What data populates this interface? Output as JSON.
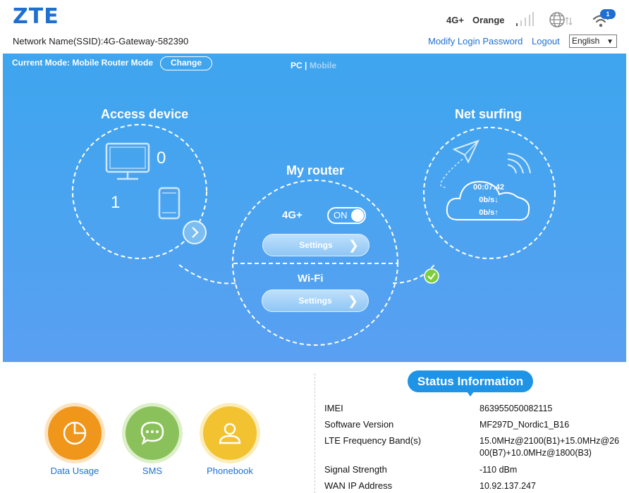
{
  "header": {
    "logo": "ZTE",
    "ssid": "Network Name(SSID):4G-Gateway-582390",
    "network_type": "4G+",
    "operator": "Orange",
    "wifi_badge": "1",
    "modify_password": "Modify Login Password",
    "logout": "Logout",
    "language": "English"
  },
  "panel": {
    "current_mode": "Current Mode: Mobile Router Mode",
    "change": "Change",
    "pc": "PC |",
    "mobile": "Mobile",
    "access_device": {
      "title": "Access device",
      "wired_count": "0",
      "wireless_count": "1"
    },
    "my_router": {
      "title": "My router",
      "mobile_label": "4G+",
      "toggle": "ON",
      "settings": "Settings",
      "wifi_label": "Wi-Fi",
      "wifi_settings": "Settings"
    },
    "net_surfing": {
      "title": "Net surfing",
      "duration": "00:07:42",
      "down": "0b/s↓",
      "up": "0b/s↑"
    }
  },
  "shortcuts": [
    {
      "label": "Data Usage",
      "color": "#f0961a"
    },
    {
      "label": "SMS",
      "color": "#8bc15a"
    },
    {
      "label": "Phonebook",
      "color": "#f2c230"
    }
  ],
  "status": {
    "title": "Status Information",
    "rows": [
      {
        "label": "IMEI",
        "value": "863955050082115"
      },
      {
        "label": "Software Version",
        "value": "MF297D_Nordic1_B16"
      },
      {
        "label": "LTE Frequency Band(s)",
        "value": "15.0MHz@2100(B1)+15.0MHz@2600(B7)+10.0MHz@1800(B3)"
      },
      {
        "label": "Signal Strength",
        "value": "-110 dBm"
      },
      {
        "label": "WAN IP Address",
        "value": "10.92.137.247"
      }
    ]
  },
  "colors": {
    "brand": "#1f6fd0",
    "panel_blue": "#4aa4f0",
    "connected_green": "#7ccf3a"
  }
}
